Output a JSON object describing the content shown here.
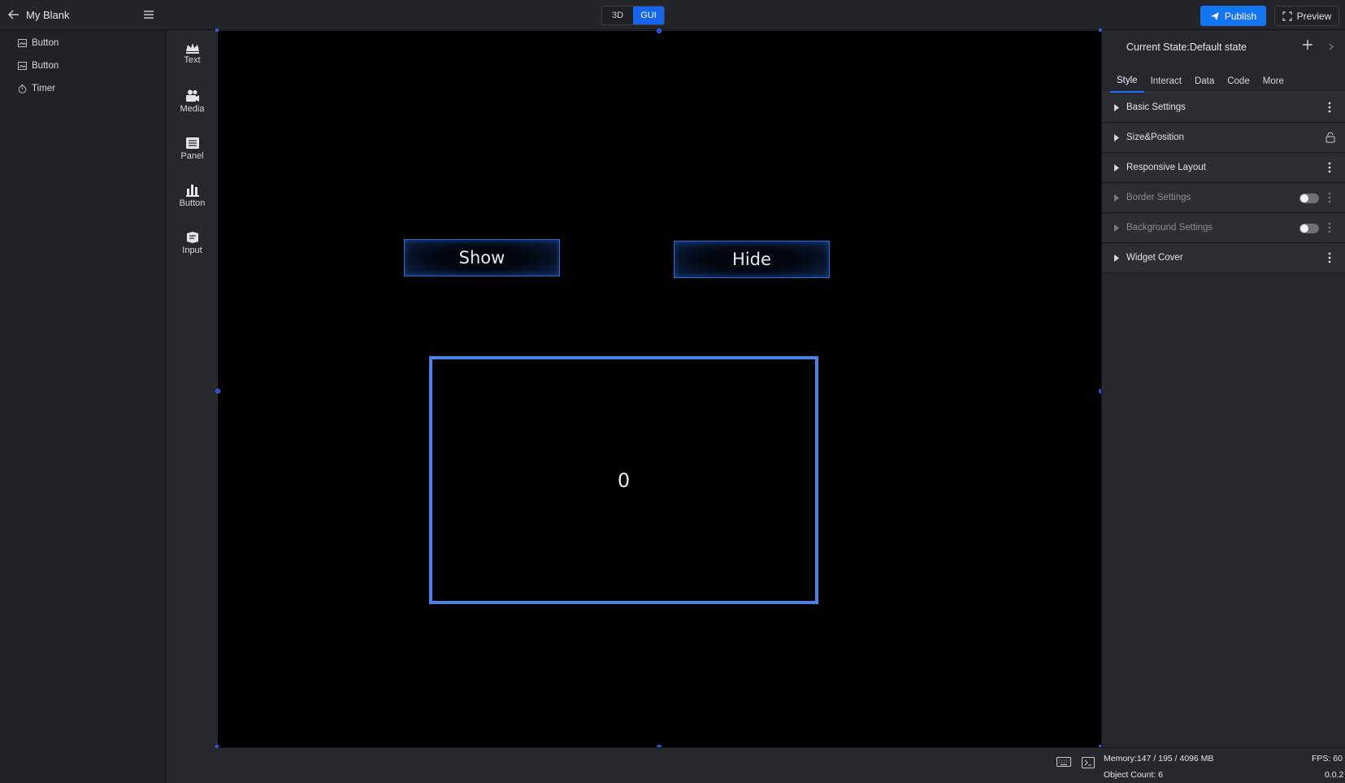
{
  "header": {
    "project_title": "My Blank",
    "modes": [
      "3D",
      "GUI"
    ],
    "active_mode": "GUI",
    "publish_label": "Publish",
    "preview_label": "Preview"
  },
  "outline": {
    "items": [
      {
        "label": "Button",
        "icon": "image-icon"
      },
      {
        "label": "Button",
        "icon": "image-icon"
      },
      {
        "label": "Timer",
        "icon": "timer-icon"
      }
    ]
  },
  "components": {
    "items": [
      {
        "label": "Text",
        "icon": "crown-icon"
      },
      {
        "label": "Media",
        "icon": "camera-icon"
      },
      {
        "label": "Panel",
        "icon": "panel-icon"
      },
      {
        "label": "Button",
        "icon": "bar-chart-icon"
      },
      {
        "label": "Input",
        "icon": "input-icon"
      }
    ]
  },
  "canvas": {
    "show_label": "Show",
    "hide_label": "Hide",
    "counter_value": "0"
  },
  "right_panel": {
    "current_state": "Current State:Default state",
    "tabs": [
      "Style",
      "Interact",
      "Data",
      "Code",
      "More"
    ],
    "active_tab": "Style",
    "sections": [
      {
        "label": "Basic Settings",
        "control": "dots",
        "enabled": true
      },
      {
        "label": "Size&Position",
        "control": "lock",
        "enabled": true
      },
      {
        "label": "Responsive Layout",
        "control": "dots",
        "enabled": true
      },
      {
        "label": "Border Settings",
        "control": "toggle",
        "enabled": false
      },
      {
        "label": "Background Settings",
        "control": "toggle",
        "enabled": false
      },
      {
        "label": "Widget Cover",
        "control": "dots",
        "enabled": true
      }
    ]
  },
  "status": {
    "memory": "Memory:147 / 195 / 4096 MB",
    "fps": "FPS: 60",
    "object_count": "Object Count: 6",
    "version": "0.0.2"
  },
  "colors": {
    "accent": "#1574f0",
    "canvas_bg": "#000000",
    "counter_border": "#4a82e8"
  }
}
